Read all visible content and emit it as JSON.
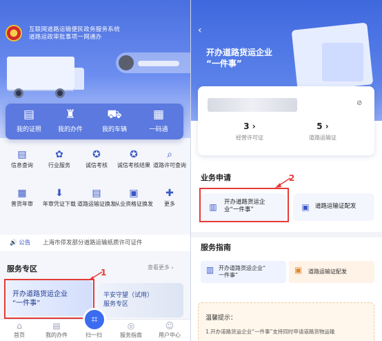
{
  "left": {
    "header": {
      "line1": "互联网道路运输便民政务服务系统",
      "line2": "道路运政审批事项一网通办"
    },
    "quick": [
      {
        "icon": "id-card-icon",
        "glyph": "▤",
        "label": "我的证照"
      },
      {
        "icon": "stamp-icon",
        "glyph": "♜",
        "label": "我的办件"
      },
      {
        "icon": "truck-icon",
        "glyph": "⛟",
        "label": "我的车辆"
      },
      {
        "icon": "qr-code-icon",
        "glyph": "▦",
        "label": "一码通"
      }
    ],
    "grid": [
      {
        "icon": "document-search-icon",
        "glyph": "▤",
        "label": "信息查询"
      },
      {
        "icon": "flower-icon",
        "glyph": "✿",
        "label": "行业服务"
      },
      {
        "icon": "medal-icon",
        "glyph": "✪",
        "label": "诚信考核"
      },
      {
        "icon": "medal-result-icon",
        "glyph": "✪",
        "label": "诚信考核结果"
      },
      {
        "icon": "permit-search-icon",
        "glyph": "⌕",
        "label": "道路许可查询"
      },
      {
        "icon": "calendar-icon",
        "glyph": "▦",
        "label": "普货年审"
      },
      {
        "icon": "download-icon",
        "glyph": "⬇",
        "label": "年审凭证下载"
      },
      {
        "icon": "id-card-icon",
        "glyph": "▤",
        "label": "道路运输证换发"
      },
      {
        "icon": "certificate-icon",
        "glyph": "▣",
        "label": "从业资格证换发"
      },
      {
        "icon": "plus-circle-icon",
        "glyph": "✚",
        "label": "更多"
      }
    ],
    "notice": {
      "tag": "公告",
      "text": "上海市停发部分道路运输纸质许可证件"
    },
    "service_zone": {
      "title": "服务专区",
      "more": "查看更多 ›",
      "card1": {
        "line1": "开办道路货运企业",
        "line2": "“一件事”"
      },
      "card2": {
        "line1": "平安守望（试用）",
        "line2": "服务专区"
      }
    },
    "tabs": [
      {
        "icon": "home-icon",
        "glyph": "⌂",
        "label": "首页"
      },
      {
        "icon": "document-icon",
        "glyph": "▤",
        "label": "我的办件"
      },
      {
        "icon": "scan-icon",
        "glyph": "⌗",
        "label": "扫一扫"
      },
      {
        "icon": "compass-icon",
        "glyph": "◎",
        "label": "服务指南"
      },
      {
        "icon": "user-icon",
        "glyph": "☺",
        "label": "用户中心"
      }
    ],
    "annotation": "1"
  },
  "right": {
    "back_icon": "‹",
    "title_line1": "开办道路货运企业",
    "title_line2": "“一件事”",
    "stats": [
      {
        "value": "3 ›",
        "label": "经营许可证"
      },
      {
        "value": "5 ›",
        "label": "道路运输证"
      }
    ],
    "business": {
      "title": "业务申请",
      "item1": {
        "icon": "building-icon",
        "line1": "开办道路货运企",
        "line2": "业“一件事”"
      },
      "item2": {
        "icon": "certificate-icon",
        "label": "道路运输证配发"
      }
    },
    "guide": {
      "title": "服务指南",
      "item1": {
        "line1": "开办道路货运企业“",
        "line2": "一件事”"
      },
      "item2": {
        "label": "道路运输证配发"
      }
    },
    "tip": {
      "title": "温馨提示：",
      "text": "1.开办道路货运企业“一件事”支持同时申请道路货物运输"
    },
    "annotation": "2"
  },
  "colors": {
    "primary": "#3b6cf0",
    "annotation": "#e53935"
  }
}
